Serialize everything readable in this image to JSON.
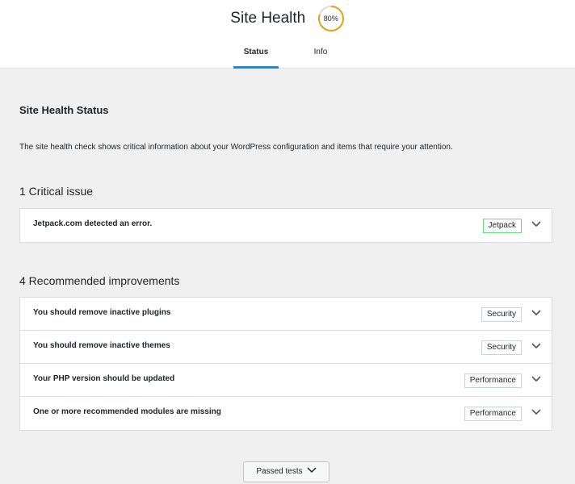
{
  "header": {
    "title": "Site Health",
    "score": "80%",
    "score_fraction": 0.8,
    "score_color": "#dba617",
    "tabs": [
      {
        "label": "Status",
        "active": true
      },
      {
        "label": "Info",
        "active": false
      }
    ]
  },
  "main": {
    "section_title": "Site Health Status",
    "description": "The site health check shows critical information about your WordPress configuration and items that require your attention.",
    "critical": {
      "heading": "1 Critical issue",
      "items": [
        {
          "label": "Jetpack.com detected an error.",
          "badge": "Jetpack",
          "badge_color": "#68de7c"
        }
      ]
    },
    "recommended": {
      "heading": "4 Recommended improvements",
      "items": [
        {
          "label": "You should remove inactive plugins",
          "badge": "Security"
        },
        {
          "label": "You should remove inactive themes",
          "badge": "Security"
        },
        {
          "label": "Your PHP version should be updated",
          "badge": "Performance"
        },
        {
          "label": "One or more recommended modules are missing",
          "badge": "Performance"
        }
      ]
    },
    "passed_button": "Passed tests",
    "icons": {
      "expand": "chevron-down-icon"
    }
  }
}
